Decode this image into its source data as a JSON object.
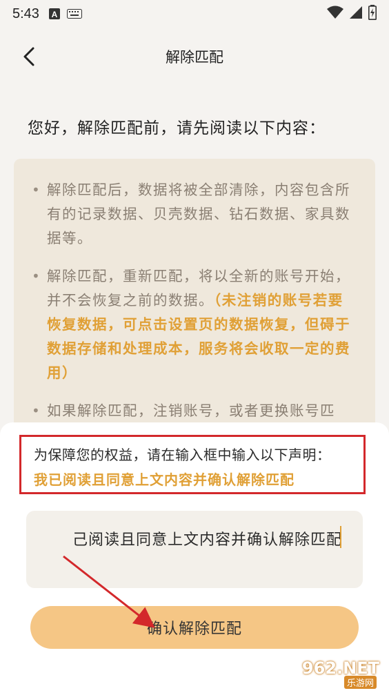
{
  "status_bar": {
    "time": "5:43",
    "icons": [
      "a-notification-icon",
      "keyboard-icon",
      "wifi-icon",
      "signal-icon",
      "battery-charging-icon"
    ]
  },
  "nav": {
    "title": "解除匹配"
  },
  "intro": "您好，解除匹配前，请先阅读以下内容：",
  "notice": {
    "items": [
      {
        "text": "解除匹配后，数据将被全部清除，内容包含所有的记录数据、贝壳数据、钻石数据、家具数据等。",
        "accent": ""
      },
      {
        "text": "解除匹配，重新匹配，将以全新的账号开始，并不会恢复之前的数据。",
        "accent": "（未注销的账号若要恢复数据，可点击设置页的数据恢复，但碍于数据存储和处理成本，服务将会收取一定的费用）"
      },
      {
        "text": "如果解除匹配，注销账号，或者更换账号匹配，原来的数据将无法被找回（包含购",
        "accent": ""
      }
    ]
  },
  "sheet": {
    "declare_instruction": "为保障您的权益，请在输入框中输入以下声明：",
    "declare_phrase": "我已阅读且同意上文内容并确认解除匹配",
    "input_value": "己阅读且同意上文内容并确认解除匹配",
    "confirm_label": "确认解除匹配"
  },
  "watermark": {
    "brand": "962.NET",
    "sub": "乐游网"
  },
  "colors": {
    "background": "#f5f3f0",
    "accent": "#e0a036",
    "button": "#f5c685",
    "highlight": "#d3282b"
  }
}
